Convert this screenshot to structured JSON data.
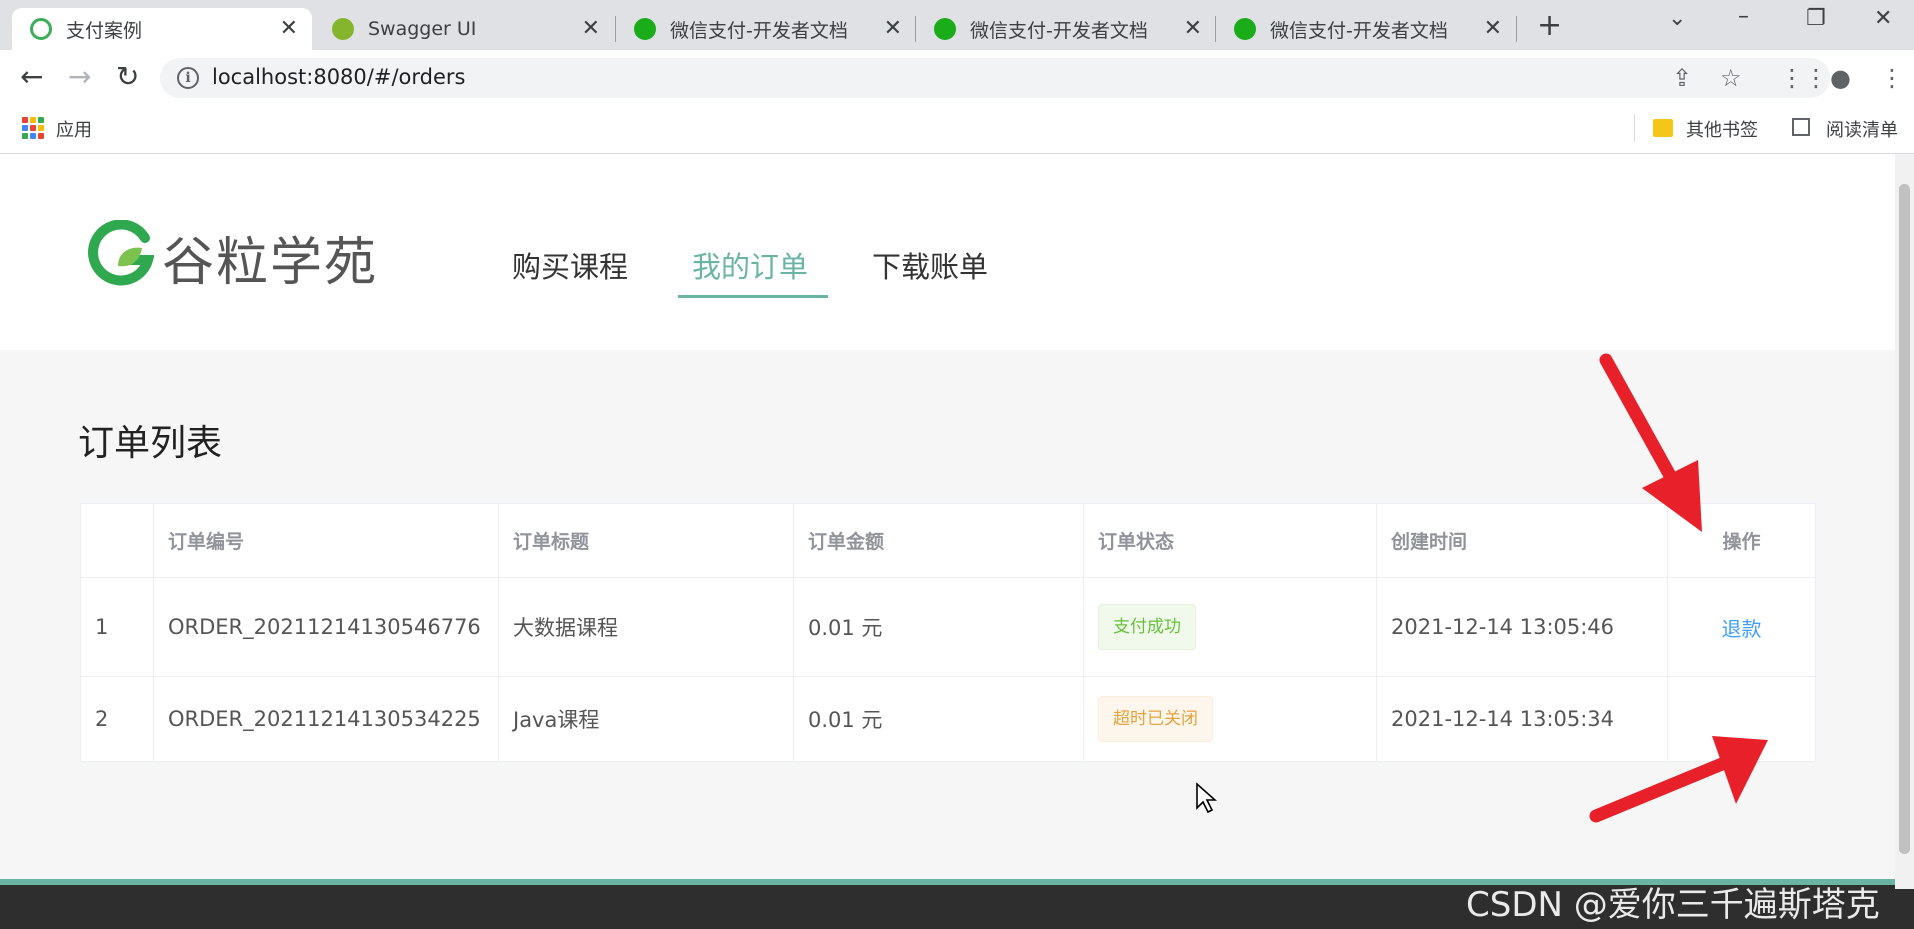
{
  "browser": {
    "tabs": [
      {
        "title": "支付案例",
        "icon": "atguigu-favicon"
      },
      {
        "title": "Swagger UI",
        "icon": "swagger-favicon"
      },
      {
        "title": "微信支付-开发者文档",
        "icon": "wechat-favicon"
      },
      {
        "title": "微信支付-开发者文档",
        "icon": "wechat-favicon"
      },
      {
        "title": "微信支付-开发者文档",
        "icon": "wechat-favicon"
      }
    ],
    "url": "localhost:8080/#/orders",
    "bookmarks": {
      "apps": "应用",
      "other": "其他书签",
      "reading_list": "阅读清单"
    }
  },
  "site": {
    "brand": "谷粒学苑",
    "nav": [
      "购买课程",
      "我的订单",
      "下载账单"
    ],
    "active_nav_index": 1,
    "accent_color": "#6ab4a4"
  },
  "orders": {
    "title": "订单列表",
    "columns": [
      "",
      "订单编号",
      "订单标题",
      "订单金额",
      "订单状态",
      "创建时间",
      "操作"
    ],
    "rows": [
      {
        "index": "1",
        "order_no": "ORDER_20211214130546776",
        "title": "大数据课程",
        "amount": "0.01 元",
        "status": "支付成功",
        "status_type": "success",
        "created": "2021-12-14 13:05:46",
        "action": "退款"
      },
      {
        "index": "2",
        "order_no": "ORDER_20211214130534225",
        "title": "Java课程",
        "amount": "0.01 元",
        "status": "超时已关闭",
        "status_type": "warning",
        "created": "2021-12-14 13:05:34",
        "action": ""
      }
    ]
  },
  "overlay": {
    "watermark": "CSDN @爱你三千遍斯塔克",
    "arrow_color": "#e8202a"
  }
}
